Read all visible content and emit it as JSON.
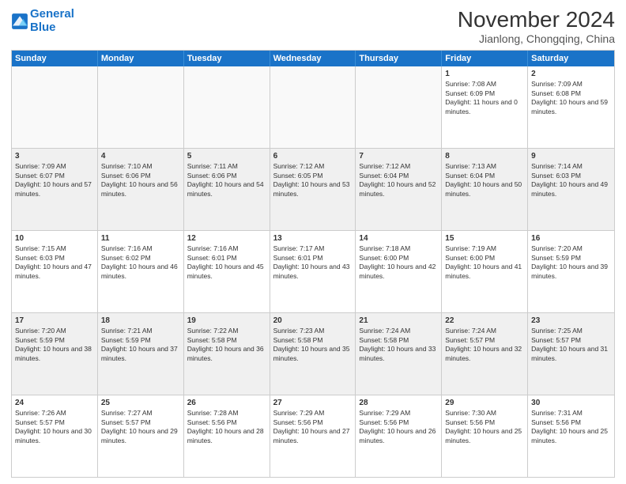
{
  "logo": {
    "line1": "General",
    "line2": "Blue"
  },
  "title": "November 2024",
  "subtitle": "Jianlong, Chongqing, China",
  "days": [
    "Sunday",
    "Monday",
    "Tuesday",
    "Wednesday",
    "Thursday",
    "Friday",
    "Saturday"
  ],
  "weeks": [
    [
      {
        "day": "",
        "empty": true
      },
      {
        "day": "",
        "empty": true
      },
      {
        "day": "",
        "empty": true
      },
      {
        "day": "",
        "empty": true
      },
      {
        "day": "",
        "empty": true
      },
      {
        "day": "1",
        "rise": "7:08 AM",
        "set": "6:09 PM",
        "daylight": "11 hours and 0 minutes."
      },
      {
        "day": "2",
        "rise": "7:09 AM",
        "set": "6:08 PM",
        "daylight": "10 hours and 59 minutes."
      }
    ],
    [
      {
        "day": "3",
        "rise": "7:09 AM",
        "set": "6:07 PM",
        "daylight": "10 hours and 57 minutes."
      },
      {
        "day": "4",
        "rise": "7:10 AM",
        "set": "6:06 PM",
        "daylight": "10 hours and 56 minutes."
      },
      {
        "day": "5",
        "rise": "7:11 AM",
        "set": "6:06 PM",
        "daylight": "10 hours and 54 minutes."
      },
      {
        "day": "6",
        "rise": "7:12 AM",
        "set": "6:05 PM",
        "daylight": "10 hours and 53 minutes."
      },
      {
        "day": "7",
        "rise": "7:12 AM",
        "set": "6:04 PM",
        "daylight": "10 hours and 52 minutes."
      },
      {
        "day": "8",
        "rise": "7:13 AM",
        "set": "6:04 PM",
        "daylight": "10 hours and 50 minutes."
      },
      {
        "day": "9",
        "rise": "7:14 AM",
        "set": "6:03 PM",
        "daylight": "10 hours and 49 minutes."
      }
    ],
    [
      {
        "day": "10",
        "rise": "7:15 AM",
        "set": "6:03 PM",
        "daylight": "10 hours and 47 minutes."
      },
      {
        "day": "11",
        "rise": "7:16 AM",
        "set": "6:02 PM",
        "daylight": "10 hours and 46 minutes."
      },
      {
        "day": "12",
        "rise": "7:16 AM",
        "set": "6:01 PM",
        "daylight": "10 hours and 45 minutes."
      },
      {
        "day": "13",
        "rise": "7:17 AM",
        "set": "6:01 PM",
        "daylight": "10 hours and 43 minutes."
      },
      {
        "day": "14",
        "rise": "7:18 AM",
        "set": "6:00 PM",
        "daylight": "10 hours and 42 minutes."
      },
      {
        "day": "15",
        "rise": "7:19 AM",
        "set": "6:00 PM",
        "daylight": "10 hours and 41 minutes."
      },
      {
        "day": "16",
        "rise": "7:20 AM",
        "set": "5:59 PM",
        "daylight": "10 hours and 39 minutes."
      }
    ],
    [
      {
        "day": "17",
        "rise": "7:20 AM",
        "set": "5:59 PM",
        "daylight": "10 hours and 38 minutes."
      },
      {
        "day": "18",
        "rise": "7:21 AM",
        "set": "5:59 PM",
        "daylight": "10 hours and 37 minutes."
      },
      {
        "day": "19",
        "rise": "7:22 AM",
        "set": "5:58 PM",
        "daylight": "10 hours and 36 minutes."
      },
      {
        "day": "20",
        "rise": "7:23 AM",
        "set": "5:58 PM",
        "daylight": "10 hours and 35 minutes."
      },
      {
        "day": "21",
        "rise": "7:24 AM",
        "set": "5:58 PM",
        "daylight": "10 hours and 33 minutes."
      },
      {
        "day": "22",
        "rise": "7:24 AM",
        "set": "5:57 PM",
        "daylight": "10 hours and 32 minutes."
      },
      {
        "day": "23",
        "rise": "7:25 AM",
        "set": "5:57 PM",
        "daylight": "10 hours and 31 minutes."
      }
    ],
    [
      {
        "day": "24",
        "rise": "7:26 AM",
        "set": "5:57 PM",
        "daylight": "10 hours and 30 minutes."
      },
      {
        "day": "25",
        "rise": "7:27 AM",
        "set": "5:57 PM",
        "daylight": "10 hours and 29 minutes."
      },
      {
        "day": "26",
        "rise": "7:28 AM",
        "set": "5:56 PM",
        "daylight": "10 hours and 28 minutes."
      },
      {
        "day": "27",
        "rise": "7:29 AM",
        "set": "5:56 PM",
        "daylight": "10 hours and 27 minutes."
      },
      {
        "day": "28",
        "rise": "7:29 AM",
        "set": "5:56 PM",
        "daylight": "10 hours and 26 minutes."
      },
      {
        "day": "29",
        "rise": "7:30 AM",
        "set": "5:56 PM",
        "daylight": "10 hours and 25 minutes."
      },
      {
        "day": "30",
        "rise": "7:31 AM",
        "set": "5:56 PM",
        "daylight": "10 hours and 25 minutes."
      }
    ]
  ]
}
